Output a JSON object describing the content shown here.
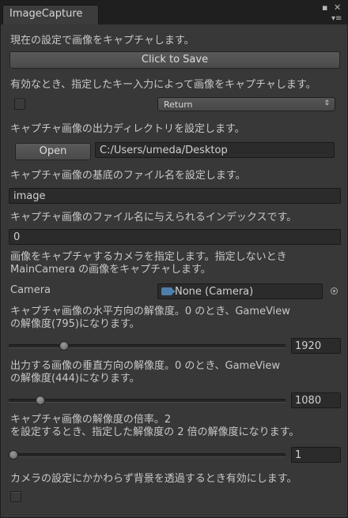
{
  "window": {
    "tab_title": "ImageCapture"
  },
  "capture": {
    "description": "現在の設定で画像をキャプチャします。",
    "button_label": "Click to Save"
  },
  "hotkey": {
    "description": "有効なとき、指定したキー入力によって画像をキャプチャします。",
    "enabled": false,
    "key": "Return"
  },
  "output_dir": {
    "description": "キャプチャ画像の出力ディレクトリを設定します。",
    "open_label": "Open",
    "path": "C:/Users/umeda/Desktop"
  },
  "file_name": {
    "description": "キャプチャ画像の基底のファイル名を設定します。",
    "value": "image"
  },
  "index": {
    "description": "キャプチャ画像のファイル名に与えられるインデックスです。",
    "value": "0"
  },
  "camera": {
    "description_line1": "画像をキャプチャするカメラを指定します。指定しないとき",
    "description_line2": "MainCamera の画像をキャプチャします。",
    "label": "Camera",
    "value": "None (Camera)"
  },
  "width": {
    "description_line1": "キャプチャ画像の水平方向の解像度。0 のとき、GameView",
    "description_line2": "の解像度(795)になります。",
    "value": "1920",
    "slider_fraction": 0.19
  },
  "height": {
    "description_line1": "出力する画像の垂直方向の解像度。0 のとき、GameView",
    "description_line2": "の解像度(444)になります。",
    "value": "1080",
    "slider_fraction": 0.1
  },
  "scale": {
    "description_line1": "キャプチャ画像の解像度の倍率。2",
    "description_line2": "を設定するとき、指定した解像度の 2 倍の解像度になります。",
    "value": "1",
    "slider_fraction": 0.0
  },
  "transparent": {
    "description": "カメラの設定にかかわらず背景を透過するとき有効にします。",
    "enabled": false
  }
}
